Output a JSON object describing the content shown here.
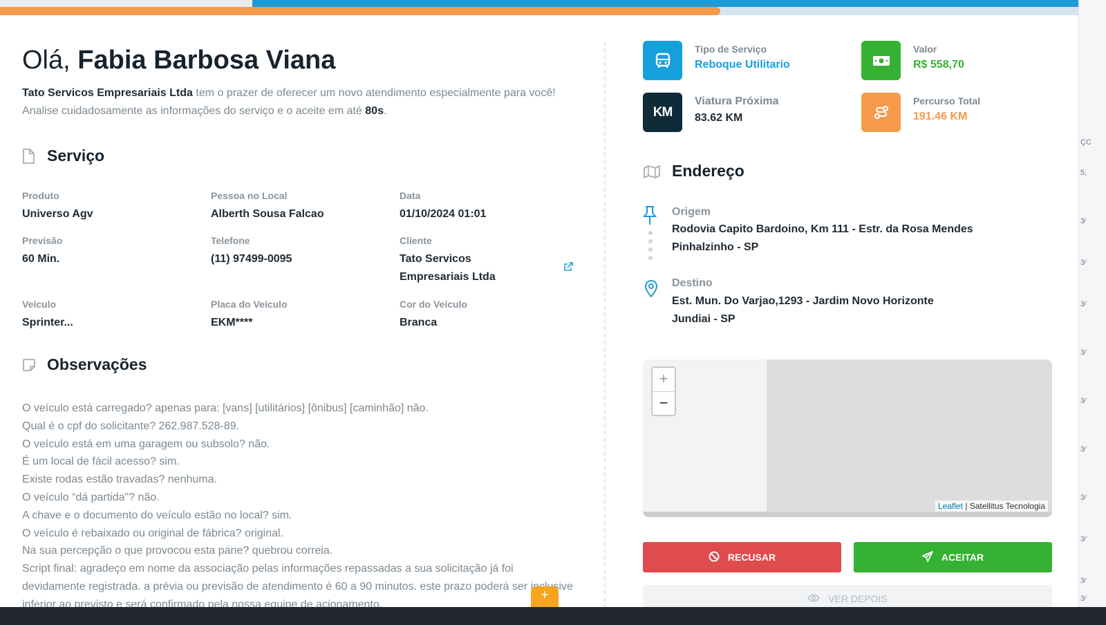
{
  "greeting": {
    "prefix": "Olá,",
    "name": "Fabia Barbosa Viana"
  },
  "intro": {
    "company": "Tato Servicos Empresariais Ltda",
    "text1": " tem o prazer de oferecer um novo atendimento especialmente para você! Analise cuidadosamente as informações do serviço e o aceite em até ",
    "deadline": "80s",
    "text2": "."
  },
  "service": {
    "title": "Serviço",
    "fields": [
      {
        "label": "Produto",
        "value": "Universo Agv"
      },
      {
        "label": "Pessoa no Local",
        "value": "Alberth Sousa Falcao"
      },
      {
        "label": "Data",
        "value": "01/10/2024 01:01"
      },
      {
        "label": "Previsão",
        "value": "60 Min."
      },
      {
        "label": "Telefone",
        "value": "(11) 97499-0095"
      },
      {
        "label": "Cliente",
        "value": "Tato Servicos Empresariais Ltda"
      },
      {
        "label": "Veículo",
        "value": "Sprinter..."
      },
      {
        "label": "Placa do Veículo",
        "value": "EKM****"
      },
      {
        "label": "Cor do Veículo",
        "value": "Branca"
      }
    ]
  },
  "observations": {
    "title": "Observações",
    "lines": [
      "O veículo está carregado? apenas para: [vans] [utilitários] [ônibus] [caminhão] não.",
      "Qual é o cpf do solicitante? 262.987.528-89.",
      "O veículo está em uma garagem ou subsolo? não.",
      "É um local de fácil acesso? sim.",
      "Existe rodas estão travadas? nenhuma.",
      "O veículo “dá partida\"? não.",
      "A chave e o documento do veículo estão no local? sim.",
      "O veículo é rebaixado ou original de fábrica? original.",
      "Na sua percepção o que provocou esta pane? quebrou correia.",
      "Script final: agradeço em nome da associação pelas informações repassadas a sua solicitação já foi devidamente registrada. a prévia ou previsão de atendimento é 60 a 90 minutos. este prazo poderá ser inclusive inferior ao previsto e será confirmado pela nossa equipe de acionamento."
    ]
  },
  "summary": {
    "service_type": {
      "label": "Tipo de Serviço",
      "value": "Reboque Utilitario",
      "color": "#15a0dc"
    },
    "amount": {
      "label": "Valor",
      "value": "R$ 558,70",
      "color": "#35b233"
    },
    "nearest": {
      "label": "Viatura Próxima",
      "value": "83.62 KM",
      "badge": "KM",
      "color": "#0f2b37"
    },
    "route": {
      "label": "Percurso Total",
      "value": "191.46 KM",
      "color": "#f59a4a"
    }
  },
  "address": {
    "title": "Endereço",
    "origin": {
      "label": "Origem",
      "line1": "Rodovia Capito Bardoino, Km 111 - Estr. da Rosa Mendes",
      "line2": "Pinhalzinho - SP"
    },
    "destination": {
      "label": "Destino",
      "line1": "Est. Mun. Do Varjao,1293 - Jardim Novo Horizonte",
      "line2": "Jundiai - SP"
    }
  },
  "map": {
    "zoom_in": "+",
    "zoom_out": "−",
    "attribution_link": "Leaflet",
    "attribution_sep": " | ",
    "attribution_text": "Satellitus Tecnologia"
  },
  "actions": {
    "refuse": "RECUSAR",
    "accept": "ACEITAR",
    "later": "VER DEPOIS",
    "fab": "+"
  },
  "background_fragments": [
    "ÇC",
    "5,",
    "3⁄",
    "3⁄",
    "3⁄",
    "3⁄",
    "3⁄",
    "3⁄",
    "3⁄",
    "3⁄",
    "3⁄",
    "3⁄"
  ],
  "icons": [
    "file-icon",
    "note-icon",
    "bus-icon",
    "money-icon",
    "route-icon",
    "map-icon",
    "pin-icon",
    "location-icon",
    "external-link-icon",
    "ban-icon",
    "send-icon",
    "eye-icon"
  ]
}
